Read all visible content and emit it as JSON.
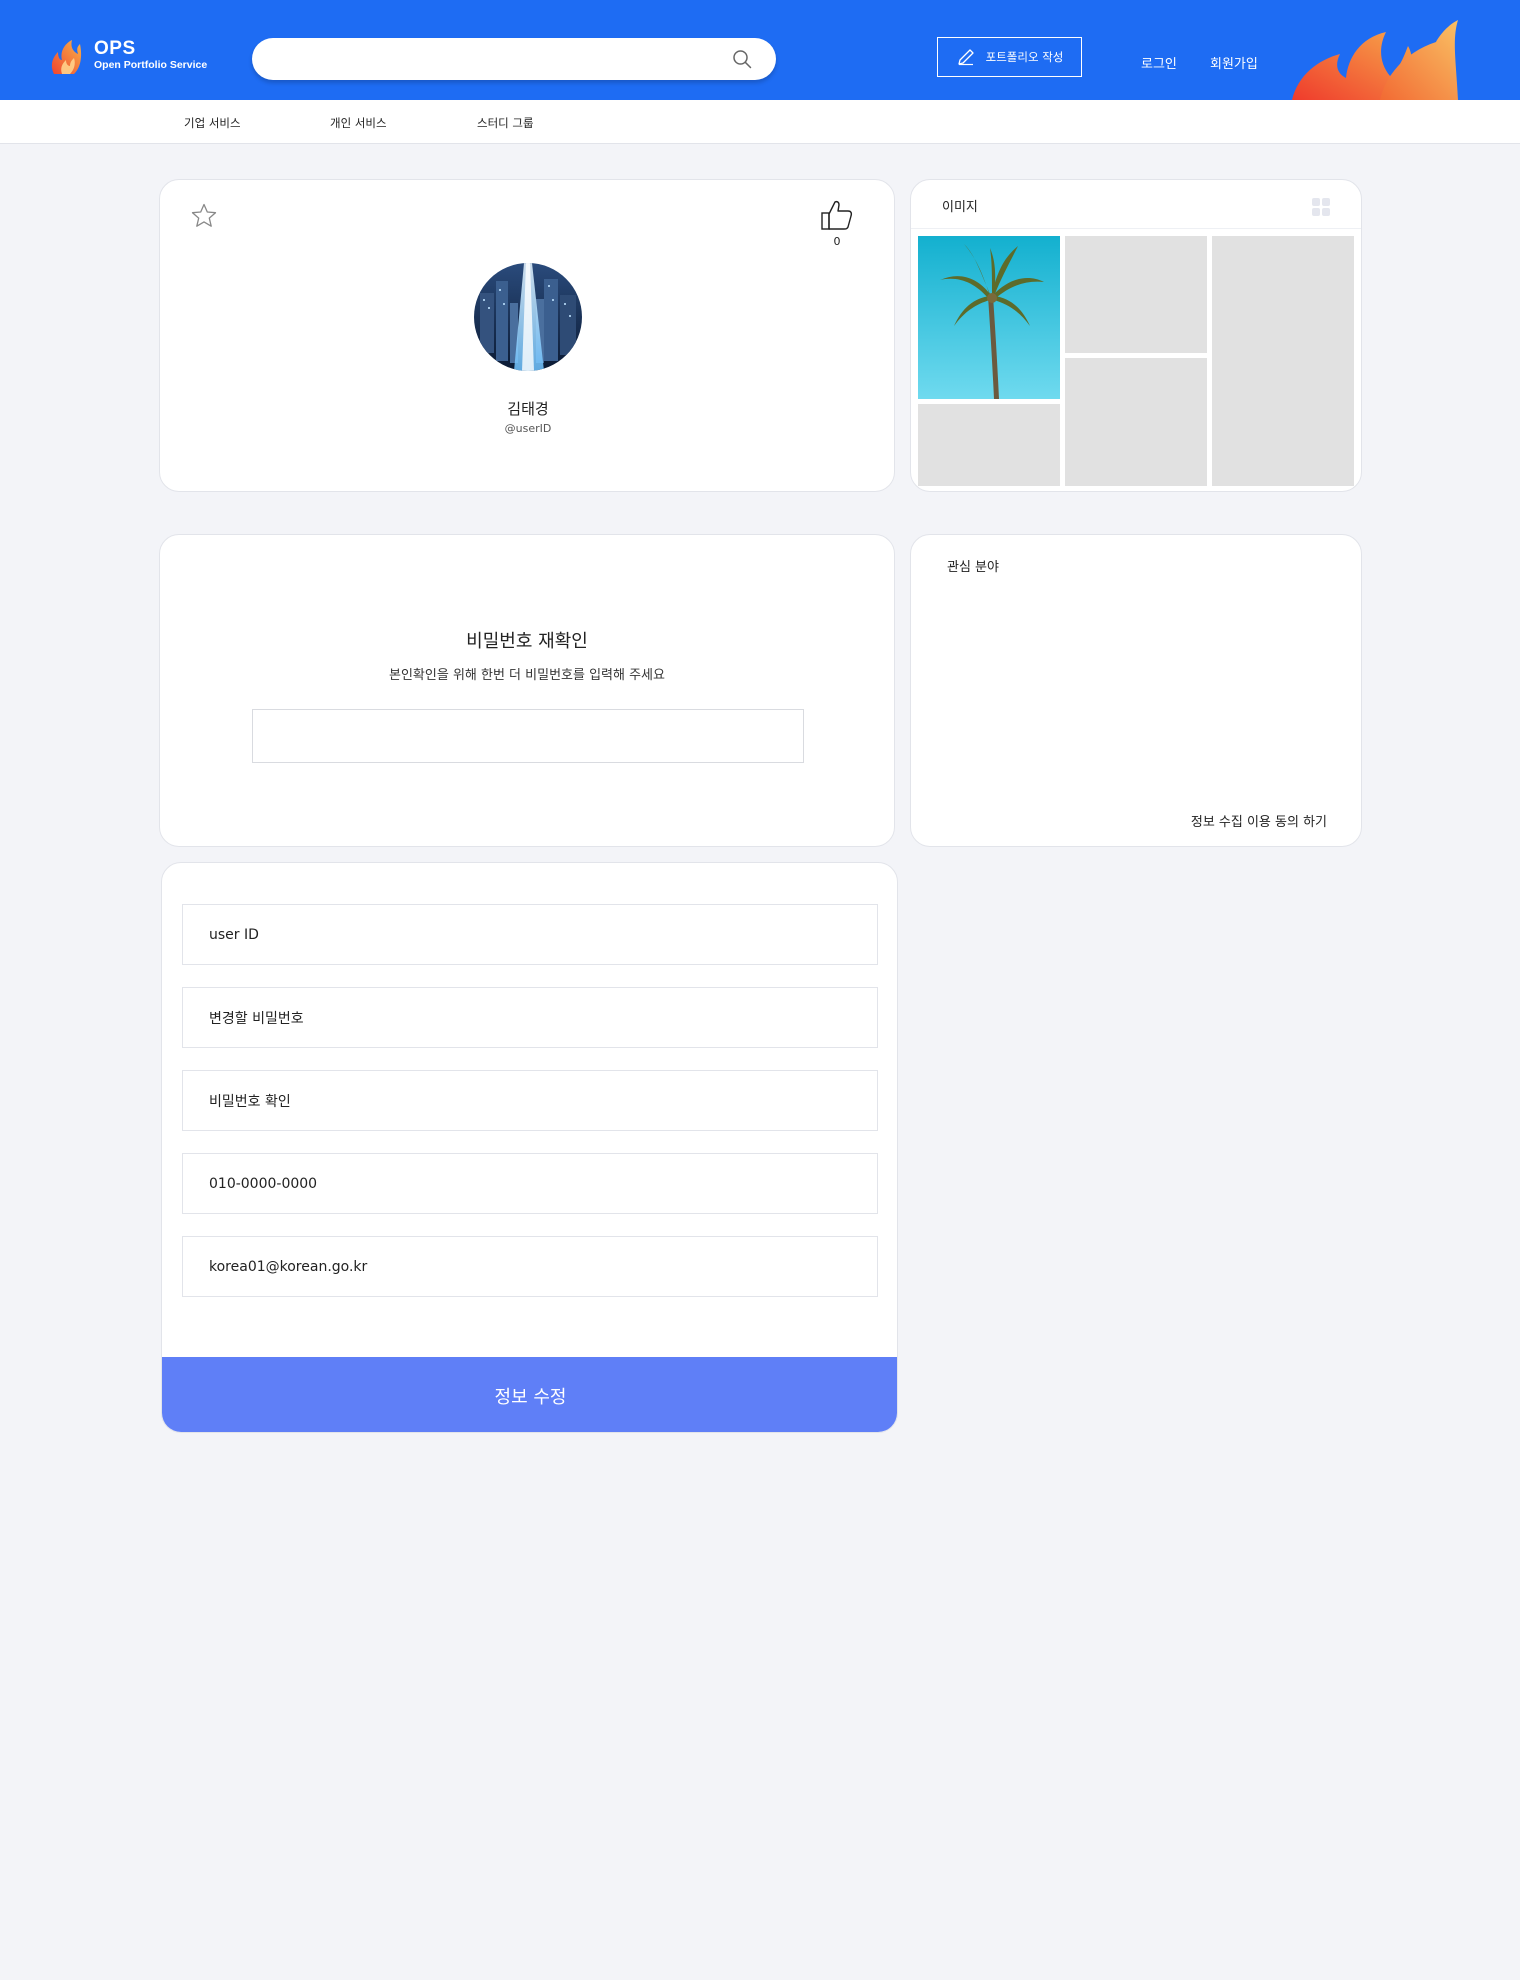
{
  "header": {
    "logo_title": "OPS",
    "logo_subtitle": "Open Portfolio Service",
    "search_placeholder": "",
    "write_button": "포트폴리오 작성",
    "login": "로그인",
    "signup": "회원가입",
    "brand_color": "#1e6cf3"
  },
  "subnav": {
    "items": [
      "기업 서비스",
      "개인 서비스",
      "스터디 그룹"
    ]
  },
  "profile": {
    "like_count": "0",
    "name": "김태경",
    "user_handle": "@userID",
    "favorite_icon": "star-icon",
    "like_icon": "thumbs-up-icon"
  },
  "gallery": {
    "title": "이미지",
    "grid_icon": "grid-icon"
  },
  "password_check": {
    "title": "비밀번호 재확인",
    "description": "본인확인을 위해 한번 더 비밀번호를 입력해 주세요",
    "input_value": ""
  },
  "interest": {
    "title": "관심 분야",
    "consent_link": "정보 수집 이용 동의 하기"
  },
  "edit_form": {
    "fields": [
      {
        "value": "user ID"
      },
      {
        "value": "변경할 비밀번호"
      },
      {
        "value": "비밀번호 확인"
      },
      {
        "value": "010-0000-0000"
      },
      {
        "value": "korea01@korean.go.kr"
      }
    ],
    "submit_label": "정보 수정",
    "submit_color": "#5f7ff7"
  }
}
